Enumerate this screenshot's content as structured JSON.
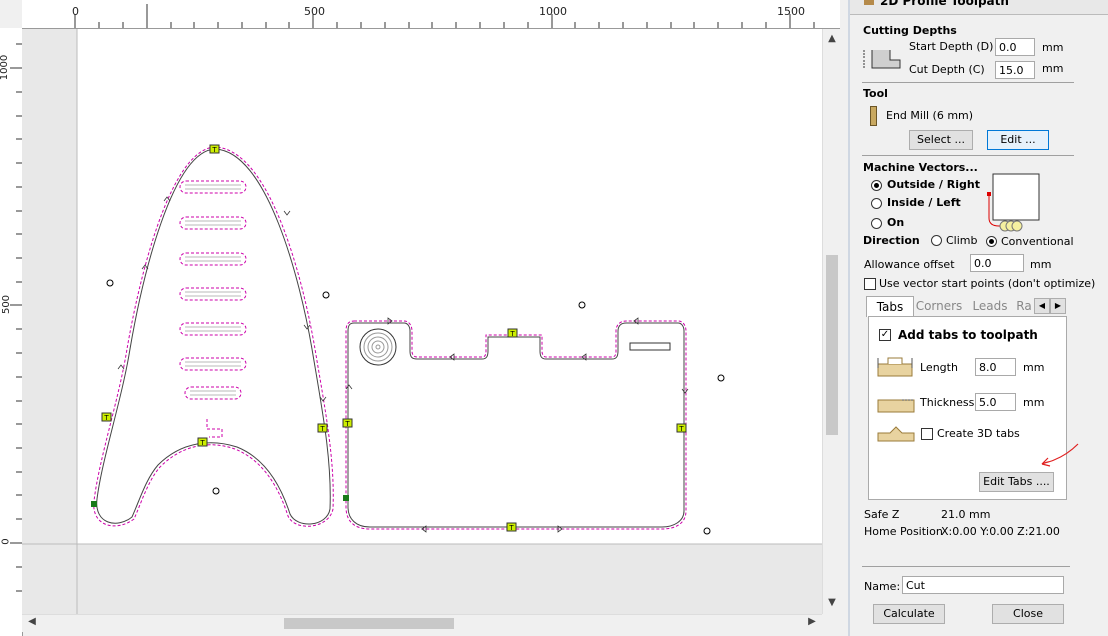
{
  "panel": {
    "title": "2D Profile Toolpath",
    "cutting_depths": {
      "header": "Cutting Depths",
      "start_label": "Start Depth (D)",
      "start_value": "0.0",
      "cut_label": "Cut Depth (C)",
      "cut_value": "15.0",
      "unit": "mm"
    },
    "tool": {
      "header": "Tool",
      "name": "End Mill (6 mm)",
      "select_label": "Select ...",
      "edit_label": "Edit ..."
    },
    "machine_vectors": {
      "header": "Machine Vectors...",
      "options": [
        "Outside / Right",
        "Inside / Left",
        "On"
      ],
      "selected": "Outside / Right"
    },
    "direction": {
      "label": "Direction",
      "options": [
        "Climb",
        "Conventional"
      ],
      "selected": "Conventional"
    },
    "allowance": {
      "label": "Allowance offset",
      "value": "0.0",
      "unit": "mm"
    },
    "vector_start": {
      "label": "Use vector start points (don't optimize)",
      "checked": false
    },
    "tabs": {
      "labels": [
        "Tabs",
        "Corners",
        "Leads",
        "Ra"
      ],
      "active": "Tabs",
      "add_tabs_label": "Add tabs to toolpath",
      "add_tabs_checked": true,
      "length_label": "Length",
      "length_value": "8.0",
      "thickness_label": "Thickness",
      "thickness_value": "5.0",
      "unit": "mm",
      "create_3d_label": "Create 3D tabs",
      "create_3d_checked": false,
      "edit_tabs_label": "Edit Tabs ...."
    },
    "safe_z": {
      "label": "Safe Z",
      "value": "21.0 mm"
    },
    "home": {
      "label": "Home Position",
      "value": "X:0.00 Y:0.00 Z:21.00"
    },
    "name": {
      "label": "Name:",
      "value": "Cut"
    },
    "calculate_label": "Calculate",
    "close_label": "Close"
  },
  "rulers": {
    "top": [
      "0",
      "500",
      "1000",
      "1500"
    ],
    "left": [
      "1000",
      "500",
      "0"
    ]
  },
  "colors": {
    "toolpath": "#cc00aa",
    "tab_marker": "#ccee00",
    "start_marker": "#1a7a1a",
    "annotation": "#e02020"
  }
}
